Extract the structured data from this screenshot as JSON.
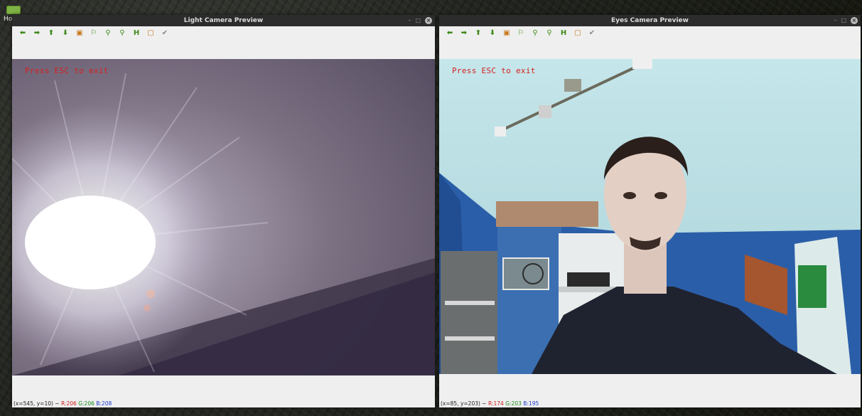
{
  "desktop": {
    "label": "Ho"
  },
  "windows": [
    {
      "id": "light",
      "title": "Light Camera Preview",
      "overlay_text": "Press ESC to exit",
      "status": {
        "coords": "(x=545, y=10) ~",
        "r": "R:206",
        "g": "G:206",
        "b": "B:208"
      }
    },
    {
      "id": "eyes",
      "title": "Eyes Camera Preview",
      "overlay_text": "Press ESC to exit",
      "status": {
        "coords": "(x=85, y=203) ~",
        "r": "R:174",
        "g": "G:203",
        "b": "B:195"
      }
    }
  ],
  "title_controls": {
    "minimize": "–",
    "maximize": "□",
    "close": "×"
  },
  "toolbar_icons": [
    "pan-left-icon",
    "pan-right-icon",
    "pan-up-icon",
    "pan-down-icon",
    "zoom-fit-icon",
    "zoom-original-icon",
    "zoom-in-icon",
    "zoom-out-icon",
    "save-icon",
    "copy-icon",
    "properties-icon"
  ]
}
